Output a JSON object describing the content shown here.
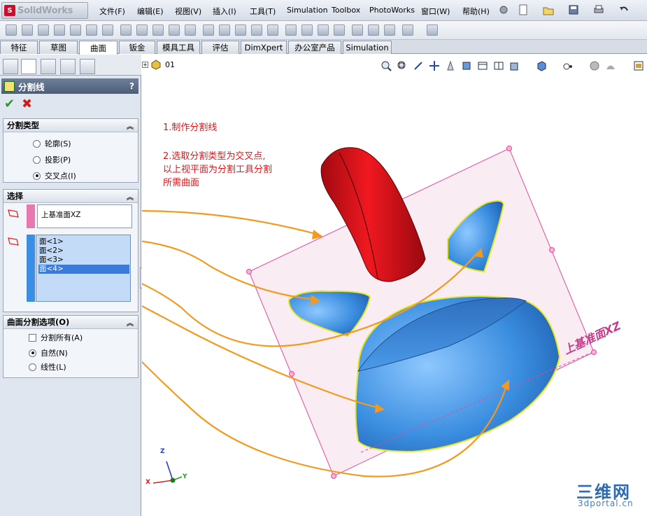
{
  "app": {
    "logo_text": "SolidWorks",
    "menu": [
      "文件(F)",
      "编辑(E)",
      "视图(V)",
      "插入(I)",
      "工具(T)",
      "Simulation",
      "Toolbox",
      "PhotoWorks",
      "窗口(W)",
      "帮助(H)"
    ]
  },
  "tabs": [
    {
      "label": "特征",
      "active": false
    },
    {
      "label": "草图",
      "active": false
    },
    {
      "label": "曲面",
      "active": true
    },
    {
      "label": "钣金",
      "active": false
    },
    {
      "label": "模具工具",
      "active": false
    },
    {
      "label": "评估",
      "active": false
    },
    {
      "label": "DimXpert",
      "active": false
    },
    {
      "label": "办公室产品",
      "active": false
    },
    {
      "label": "Simulation",
      "active": false
    }
  ],
  "property_manager": {
    "title": "分割线",
    "help": "?",
    "ok_symbol": "✔",
    "cancel_symbol": "✖",
    "split_type": {
      "heading": "分割类型",
      "options": [
        {
          "label": "轮廓(S)",
          "selected": false
        },
        {
          "label": "投影(P)",
          "selected": false
        },
        {
          "label": "交叉点(I)",
          "selected": true
        }
      ]
    },
    "selection": {
      "heading": "选择",
      "tool_value": "上基准面XZ",
      "faces": [
        "面<1>",
        "面<2>",
        "面<3>",
        "面<4>"
      ],
      "selected_face_index": 3
    },
    "surface_split_options": {
      "heading": "曲面分割选项(O)",
      "split_all": {
        "label": "分割所有(A)",
        "checked": false
      },
      "options": [
        {
          "label": "自然(N)",
          "selected": true
        },
        {
          "label": "线性(L)",
          "selected": false
        }
      ]
    }
  },
  "graphics": {
    "tree_root": "01",
    "annotation_1": "1.制作分割线",
    "annotation_2_lines": [
      "2.选取分割类型为交叉点,",
      "以上视平面为分割工具分割",
      "所需曲面"
    ],
    "plane_label": "上基准面XZ",
    "triad_labels": {
      "x": "X",
      "y": "Y",
      "z": "Z"
    },
    "colors": {
      "annotation": "#e0161b",
      "arrow": "#f39a1e",
      "plane": "#e8489a",
      "surface": "#3b8ee0",
      "red_body": "#d8121b",
      "edge": "#e8e81e"
    }
  },
  "watermark": {
    "brand": "三维网",
    "url": "3dportal.cn"
  }
}
